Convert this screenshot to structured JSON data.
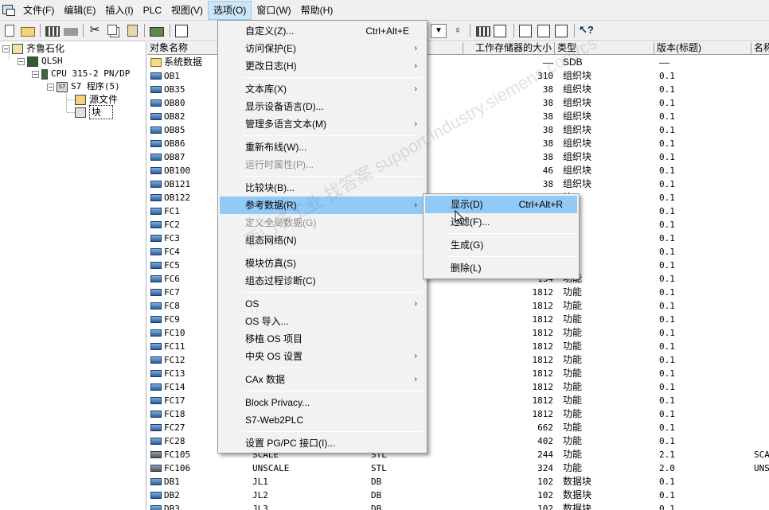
{
  "menubar": {
    "items": [
      "文件(F)",
      "编辑(E)",
      "插入(I)",
      "PLC",
      "视图(V)",
      "选项(O)",
      "窗口(W)",
      "帮助(H)"
    ]
  },
  "toolbar": {
    "icons": [
      "new-icon",
      "open-icon",
      "network-icon",
      "gray-icon",
      "cut-icon",
      "copy-icon",
      "paste-icon",
      "download-icon",
      "monitor-icon",
      "properties-icon",
      "grid-icon",
      "window-icon",
      "layout-icon",
      "help-icon"
    ]
  },
  "tree": {
    "project": "齐鲁石化",
    "station": "QLSH",
    "cpu": "CPU 315-2 PN/DP",
    "program": "S7 程序(5)",
    "sources": "源文件",
    "blocks": "块"
  },
  "list": {
    "headers": [
      "对象名称",
      "工作存储器的大小",
      "类型",
      "版本(标题)",
      "名称"
    ],
    "rows": [
      {
        "name": "系统数据",
        "symbol": "",
        "lang": "",
        "size": "——",
        "type": "SDB",
        "version": "——",
        "extra": ""
      },
      {
        "name": "OB1",
        "symbol": "",
        "lang": "",
        "size": "310",
        "type": "组织块",
        "version": "0.1",
        "extra": ""
      },
      {
        "name": "OB35",
        "symbol": "",
        "lang": "",
        "size": "38",
        "type": "组织块",
        "version": "0.1",
        "extra": ""
      },
      {
        "name": "OB80",
        "symbol": "",
        "lang": "",
        "size": "38",
        "type": "组织块",
        "version": "0.1",
        "extra": ""
      },
      {
        "name": "OB82",
        "symbol": "",
        "lang": "",
        "size": "38",
        "type": "组织块",
        "version": "0.1",
        "extra": ""
      },
      {
        "name": "OB85",
        "symbol": "",
        "lang": "",
        "size": "38",
        "type": "组织块",
        "version": "0.1",
        "extra": ""
      },
      {
        "name": "OB86",
        "symbol": "",
        "lang": "",
        "size": "38",
        "type": "组织块",
        "version": "0.1",
        "extra": ""
      },
      {
        "name": "OB87",
        "symbol": "",
        "lang": "",
        "size": "38",
        "type": "组织块",
        "version": "0.1",
        "extra": ""
      },
      {
        "name": "OB100",
        "symbol": "",
        "lang": "",
        "size": "46",
        "type": "组织块",
        "version": "0.1",
        "extra": ""
      },
      {
        "name": "OB121",
        "symbol": "",
        "lang": "",
        "size": "38",
        "type": "组织块",
        "version": "0.1",
        "extra": ""
      },
      {
        "name": "OB122",
        "symbol": "",
        "lang": "",
        "size": "",
        "type": "块",
        "version": "0.1",
        "extra": ""
      },
      {
        "name": "FC1",
        "symbol": "",
        "lang": "",
        "size": "",
        "type": "",
        "version": "0.1",
        "extra": ""
      },
      {
        "name": "FC2",
        "symbol": "",
        "lang": "",
        "size": "",
        "type": "",
        "version": "0.1",
        "extra": ""
      },
      {
        "name": "FC3",
        "symbol": "",
        "lang": "",
        "size": "",
        "type": "",
        "version": "0.1",
        "extra": ""
      },
      {
        "name": "FC4",
        "symbol": "",
        "lang": "",
        "size": "",
        "type": "",
        "version": "0.1",
        "extra": ""
      },
      {
        "name": "FC5",
        "symbol": "",
        "lang": "",
        "size": "",
        "type": "",
        "version": "0.1",
        "extra": ""
      },
      {
        "name": "FC6",
        "symbol": "",
        "lang": "",
        "size": "134",
        "type": "功能",
        "version": "0.1",
        "extra": ""
      },
      {
        "name": "FC7",
        "symbol": "",
        "lang": "",
        "size": "1812",
        "type": "功能",
        "version": "0.1",
        "extra": ""
      },
      {
        "name": "FC8",
        "symbol": "",
        "lang": "",
        "size": "1812",
        "type": "功能",
        "version": "0.1",
        "extra": ""
      },
      {
        "name": "FC9",
        "symbol": "",
        "lang": "",
        "size": "1812",
        "type": "功能",
        "version": "0.1",
        "extra": ""
      },
      {
        "name": "FC10",
        "symbol": "",
        "lang": "",
        "size": "1812",
        "type": "功能",
        "version": "0.1",
        "extra": ""
      },
      {
        "name": "FC11",
        "symbol": "",
        "lang": "",
        "size": "1812",
        "type": "功能",
        "version": "0.1",
        "extra": ""
      },
      {
        "name": "FC12",
        "symbol": "",
        "lang": "",
        "size": "1812",
        "type": "功能",
        "version": "0.1",
        "extra": ""
      },
      {
        "name": "FC13",
        "symbol": "",
        "lang": "",
        "size": "1812",
        "type": "功能",
        "version": "0.1",
        "extra": ""
      },
      {
        "name": "FC14",
        "symbol": "",
        "lang": "",
        "size": "1812",
        "type": "功能",
        "version": "0.1",
        "extra": ""
      },
      {
        "name": "FC17",
        "symbol": "",
        "lang": "",
        "size": "1812",
        "type": "功能",
        "version": "0.1",
        "extra": ""
      },
      {
        "name": "FC18",
        "symbol": "",
        "lang": "",
        "size": "1812",
        "type": "功能",
        "version": "0.1",
        "extra": ""
      },
      {
        "name": "FC27",
        "symbol": "",
        "lang": "",
        "size": "662",
        "type": "功能",
        "version": "0.1",
        "extra": ""
      },
      {
        "name": "FC28",
        "symbol": "",
        "lang": "",
        "size": "402",
        "type": "功能",
        "version": "0.1",
        "extra": ""
      },
      {
        "name": "FC105",
        "symbol": "SCALE",
        "lang": "STL",
        "size": "244",
        "type": "功能",
        "version": "2.1",
        "extra": "SCA"
      },
      {
        "name": "FC106",
        "symbol": "UNSCALE",
        "lang": "STL",
        "size": "324",
        "type": "功能",
        "version": "2.0",
        "extra": "UNS"
      },
      {
        "name": "DB1",
        "symbol": "JL1",
        "lang": "DB",
        "size": "102",
        "type": "数据块",
        "version": "0.1",
        "extra": ""
      },
      {
        "name": "DB2",
        "symbol": "JL2",
        "lang": "DB",
        "size": "102",
        "type": "数据块",
        "version": "0.1",
        "extra": ""
      },
      {
        "name": "DB3",
        "symbol": "JL3",
        "lang": "DB",
        "size": "102",
        "type": "数据块",
        "version": "0.1",
        "extra": ""
      }
    ]
  },
  "options_menu": {
    "items": [
      {
        "label": "自定义(Z)...",
        "accel": "Ctrl+Alt+E",
        "submenu": false,
        "disabled": false
      },
      {
        "label": "访问保护(E)",
        "accel": "",
        "submenu": true,
        "disabled": false
      },
      {
        "label": "更改日志(H)",
        "accel": "",
        "submenu": true,
        "disabled": false
      },
      {
        "label": "文本库(X)",
        "accel": "",
        "submenu": true,
        "disabled": false
      },
      {
        "label": "显示设备语言(D)...",
        "accel": "",
        "submenu": false,
        "disabled": false
      },
      {
        "label": "管理多语言文本(M)",
        "accel": "",
        "submenu": true,
        "disabled": false
      },
      {
        "label": "重新布线(W)...",
        "accel": "",
        "submenu": false,
        "disabled": false
      },
      {
        "label": "运行时属性(P)...",
        "accel": "",
        "submenu": false,
        "disabled": true
      },
      {
        "label": "比较块(B)...",
        "accel": "",
        "submenu": false,
        "disabled": false
      },
      {
        "label": "参考数据(R)",
        "accel": "",
        "submenu": true,
        "disabled": false
      },
      {
        "label": "定义全局数据(G)",
        "accel": "",
        "submenu": false,
        "disabled": true
      },
      {
        "label": "组态网络(N)",
        "accel": "",
        "submenu": false,
        "disabled": false
      },
      {
        "label": "模块仿真(S)",
        "accel": "",
        "submenu": false,
        "disabled": false
      },
      {
        "label": "组态过程诊断(C)",
        "accel": "",
        "submenu": false,
        "disabled": false
      },
      {
        "label": "OS",
        "accel": "",
        "submenu": true,
        "disabled": false
      },
      {
        "label": "OS 导入...",
        "accel": "",
        "submenu": false,
        "disabled": false
      },
      {
        "label": "移植 OS 项目",
        "accel": "",
        "submenu": false,
        "disabled": false
      },
      {
        "label": "中央 OS 设置",
        "accel": "",
        "submenu": true,
        "disabled": false
      },
      {
        "label": "CAx 数据",
        "accel": "",
        "submenu": true,
        "disabled": false
      },
      {
        "label": "Block Privacy...",
        "accel": "",
        "submenu": false,
        "disabled": false
      },
      {
        "label": "S7-Web2PLC",
        "accel": "",
        "submenu": false,
        "disabled": false
      },
      {
        "label": "设置 PG/PC 接口(I)...",
        "accel": "",
        "submenu": false,
        "disabled": false
      }
    ]
  },
  "reference_submenu": {
    "items": [
      {
        "label": "显示(D)",
        "accel": "Ctrl+Alt+R"
      },
      {
        "label": "过滤(F)...",
        "accel": ""
      },
      {
        "label": "生成(G)",
        "accel": ""
      },
      {
        "label": "删除(L)",
        "accel": ""
      }
    ]
  },
  "watermark": "西门子工业 找答案 support.industry.siemens.com/cs",
  "colors": {
    "highlight": "#91c9f7",
    "menu_bg": "#f2f2f2",
    "active_menu": "#cde6f7"
  }
}
